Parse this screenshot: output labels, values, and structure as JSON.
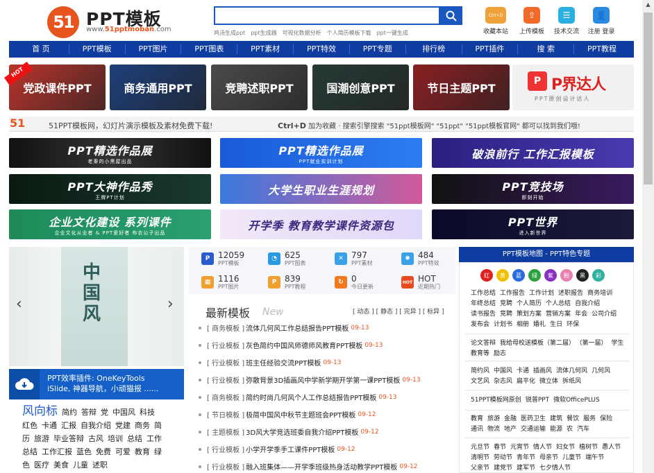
{
  "header": {
    "logo_mark": "51",
    "logo_title": "PPT模板",
    "logo_url_prefix": "www.",
    "logo_url_brand": "51pptmoban",
    "logo_url_suffix": ".com",
    "search_value": "",
    "hot_words": [
      "鸡汤生成ppt",
      "ppt生成器",
      "可视化数据分析",
      "个人简历模板下载",
      "ppt一键生成"
    ],
    "tools": [
      {
        "label": "收藏本站",
        "icon": "ctrl-d-icon",
        "glyph": "Ctrl+D",
        "color": "#f0a23a"
      },
      {
        "label": "上传模板",
        "icon": "upload-icon",
        "glyph": "⇧",
        "color": "#f06a2a"
      },
      {
        "label": "技术交流",
        "icon": "chat-icon",
        "glyph": "☰",
        "color": "#2ab0e0"
      },
      {
        "label": "注册 登录",
        "icon": "user-icon",
        "glyph": "👤",
        "color": "#2a8ae0"
      }
    ]
  },
  "nav": [
    "首 页",
    "PPT模板",
    "PPT图片",
    "PPT图表",
    "PPT素材",
    "PPT特效",
    "PPT专题",
    "排行榜",
    "PPT插件",
    "搜 索",
    "PPT教程"
  ],
  "categories": [
    {
      "label": "党政课件PPT",
      "badge": "HOT",
      "color": "#b8342c"
    },
    {
      "label": "商务通用PPT",
      "color": "#1d3f7a"
    },
    {
      "label": "竞聘述职PPT",
      "color": "#4a4a4a"
    },
    {
      "label": "国潮创意PPT",
      "color": "#263a36"
    },
    {
      "label": "节日主题PPT",
      "color": "#8a1f22"
    }
  ],
  "brand_tile": {
    "mark": "P",
    "name": "P界达人",
    "sub": "PPT原创设计达人"
  },
  "slogan": {
    "logo": "51",
    "text": "51PPT模板网，幻灯片演示模板及素材免费下载!",
    "shortcut": "Ctrl+D",
    "right_text": "加为收藏 · 搜索引擎搜索 \"51ppt模板网\" \"51ppt\" \"51ppt模板官网\" 都可以找到我们哦!"
  },
  "banners": [
    {
      "label": "PPT精选作品展",
      "sub": "老秦的小黑屋出品"
    },
    {
      "label": "PPT精选作品展",
      "sub": "PPT就业实训计划"
    },
    {
      "label": "破浪前行 工作汇报模板",
      "sub": ""
    },
    {
      "label": "PPT大神作品秀",
      "sub": "王牌PT计划"
    },
    {
      "label": "大学生职业生涯规划",
      "sub": ""
    },
    {
      "label": "PPT竞技场",
      "sub": "即刻开始"
    },
    {
      "label": "企业文化建设 系列课件",
      "sub": "企业文化从业者 & PPT爱好者 布衣公子出品"
    },
    {
      "label": "开学季 教育教学课件资源包",
      "sub": ""
    },
    {
      "label": "PPT世界",
      "sub": "进入新世界"
    }
  ],
  "slider": {
    "title": "中国风"
  },
  "plugin": {
    "line1": "PPT效率插件: OneKeyTools",
    "line2": "iSlide, 神器导航，小顽猫报 ......"
  },
  "tag_cloud": [
    {
      "t": "风向标",
      "big": true
    },
    {
      "t": "简约"
    },
    {
      "t": "答辩"
    },
    {
      "t": "党"
    },
    {
      "t": "中国风"
    },
    {
      "t": "科技"
    },
    {
      "t": "红色"
    },
    {
      "t": "卡通"
    },
    {
      "t": "汇报"
    },
    {
      "t": "自我介绍"
    },
    {
      "t": "党建"
    },
    {
      "t": "商务"
    },
    {
      "t": "简"
    },
    {
      "t": "历"
    },
    {
      "t": "旅游"
    },
    {
      "t": "毕业答辩"
    },
    {
      "t": "古风"
    },
    {
      "t": "培训"
    },
    {
      "t": "总结"
    },
    {
      "t": "工作"
    },
    {
      "t": "总结"
    },
    {
      "t": "工作汇报"
    },
    {
      "t": "蓝色"
    },
    {
      "t": "免费"
    },
    {
      "t": "可爱"
    },
    {
      "t": "教育"
    },
    {
      "t": "绿"
    },
    {
      "t": "色"
    },
    {
      "t": "医疗"
    },
    {
      "t": "美食"
    },
    {
      "t": "儿童"
    },
    {
      "t": "述职"
    }
  ],
  "stats": [
    {
      "num": "12059",
      "label": "PPT模板",
      "color": "#2a5ad0",
      "icon": "ppt-template-icon",
      "glyph": "P"
    },
    {
      "num": "625",
      "label": "PPT图表",
      "color": "#2a9ae0",
      "icon": "pie-chart-icon",
      "glyph": "◔"
    },
    {
      "num": "797",
      "label": "PPT素材",
      "color": "#3aa0e8",
      "icon": "material-icon",
      "glyph": "✕"
    },
    {
      "num": "484",
      "label": "PPT特效",
      "color": "#3aa0e8",
      "icon": "effect-icon",
      "glyph": "✺"
    },
    {
      "num": "1116",
      "label": "PPT图片",
      "color": "#f0a030",
      "icon": "image-icon",
      "glyph": "▦"
    },
    {
      "num": "839",
      "label": "PPT教程",
      "color": "#f0a030",
      "icon": "tutorial-icon",
      "glyph": "P"
    },
    {
      "num": "0",
      "label": "今日更新",
      "color": "#f07a20",
      "icon": "refresh-icon",
      "glyph": "↻"
    },
    {
      "num": "HOT",
      "label": "近期热门",
      "color": "#e84a1e",
      "icon": "hot-icon",
      "glyph": "HOT"
    }
  ],
  "latest": {
    "title": "最新模板",
    "sub": "New",
    "filters": "[ 动态 ] [ 静态 ] [ 完异 ] [ 标异 ]",
    "items": [
      {
        "cat": "[ 商务模板 ]",
        "name": "流体几何风工作总结报告PPT模板",
        "date": "09-13"
      },
      {
        "cat": "[ 行业模板 ]",
        "name": "灰色简约中国风师德师风教育PPT模板",
        "date": "09-13"
      },
      {
        "cat": "[ 行业模板 ]",
        "name": "班主任经验交流PPT模板",
        "date": "09-13"
      },
      {
        "cat": "[ 行业模板 ]",
        "name": "弥散背景3D插画风中学新学期开学第一课PPT模板",
        "date": "09-13"
      },
      {
        "cat": "[ 商务模板 ]",
        "name": "简约时尚几何风个人工作总结报告PPT模板",
        "date": "09-13"
      },
      {
        "cat": "[ 节日模板 ]",
        "name": "极简中国风中秋节主题班会PPT模板",
        "date": "09-12"
      },
      {
        "cat": "[ 主题模板 ]",
        "name": "3D风大学竞选班委自我介绍PPT模板",
        "date": "09-12"
      },
      {
        "cat": "[ 行业模板 ]",
        "name": "小学开学季手工课件PPT模板",
        "date": "09-12"
      },
      {
        "cat": "[ 行业模板 ]",
        "name": "融入班集体——开学季班级热身活动教学PPT模板",
        "date": "09-12"
      }
    ]
  },
  "right_panel": {
    "title": "PPT模板地图 - PPT特色专题",
    "colors": [
      {
        "t": "红",
        "c": "#e02020"
      },
      {
        "t": "黄",
        "c": "#f0c000"
      },
      {
        "t": "蓝",
        "c": "#2a6ae0"
      },
      {
        "t": "绿",
        "c": "#2aa040"
      },
      {
        "t": "紫",
        "c": "#8a30c0"
      },
      {
        "t": "粉",
        "c": "#e880b0"
      },
      {
        "t": "黑",
        "c": "#222222"
      },
      {
        "t": "彩",
        "c": "#30b0a0"
      }
    ],
    "group1": [
      "工作总结",
      "工作报告",
      "工作计划",
      "述职报告",
      "商务培训",
      "年终总结",
      "竞聘",
      "个人简历",
      "个人总结",
      "自我介绍",
      "读书报告",
      "竞聘",
      "策划方案",
      "营销方案",
      "年会",
      "公司介绍",
      "发布会",
      "计划书",
      "相册",
      "婚礼",
      "生日",
      "环保"
    ],
    "group2": [
      "论文答辩",
      "我给母校送模板（第二届）",
      "（第一届）",
      "学生",
      "教育等",
      "励志"
    ],
    "group3": [
      "简约风",
      "中国风",
      "卡通",
      "插画风",
      "流体几何风",
      "几何风",
      "文艺风",
      "杂志风",
      "扁平化",
      "微立体",
      "拆纸风"
    ],
    "group4": [
      "51PPT模板网原创",
      "锐普PPT",
      "微软OfficePLUS"
    ],
    "group5": [
      "教育",
      "旅游",
      "金融",
      "医药卫生",
      "建筑",
      "餐饮",
      "服务",
      "保险",
      "通讯",
      "物流",
      "地产",
      "交通运输",
      "能源",
      "农",
      "汽车"
    ],
    "group6": [
      "元旦节",
      "春节",
      "元宵节",
      "情人节",
      "妇女节",
      "植树节",
      "愚人节",
      "清明节",
      "劳动节",
      "青年节",
      "母亲节",
      "儿童节",
      "端午节",
      "父亲节",
      "建党节",
      "建军节",
      "七夕情人节"
    ]
  }
}
